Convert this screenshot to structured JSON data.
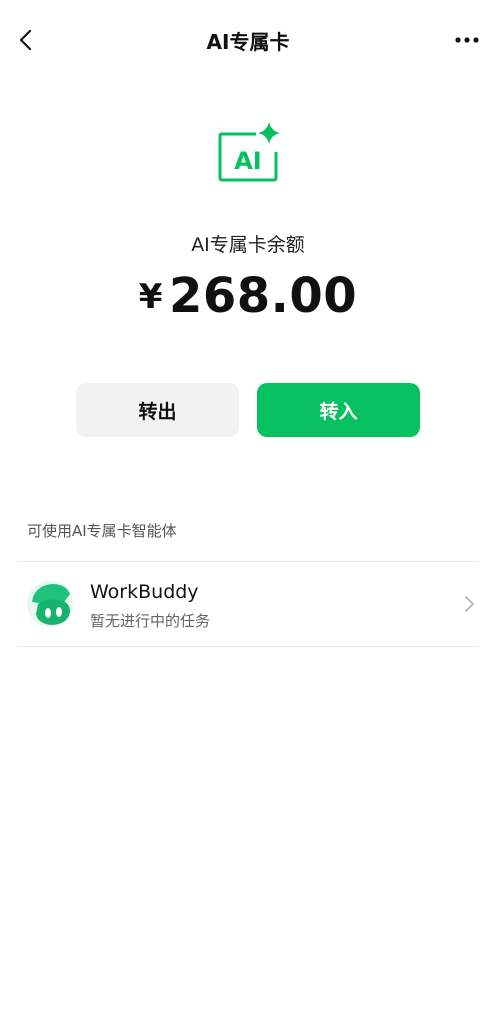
{
  "nav": {
    "title": "AI专属卡"
  },
  "header": {
    "icon_text": "AI",
    "balance_label": "AI专属卡余额",
    "currency": "¥",
    "amount": "268.00"
  },
  "actions": {
    "transfer_out_label": "转出",
    "transfer_in_label": "转入"
  },
  "agents_section": {
    "title": "可使用AI专属卡智能体",
    "items": [
      {
        "name": "WorkBuddy",
        "status": "暂无进行中的任务"
      }
    ]
  },
  "colors": {
    "accent": "#07c160",
    "secondary_button": "#f2f2f2"
  },
  "icons": {
    "back": "chevron-left-icon",
    "more": "more-horizontal-icon",
    "ai_card": "ai-sparkle-icon",
    "row_chevron": "chevron-right-icon"
  }
}
